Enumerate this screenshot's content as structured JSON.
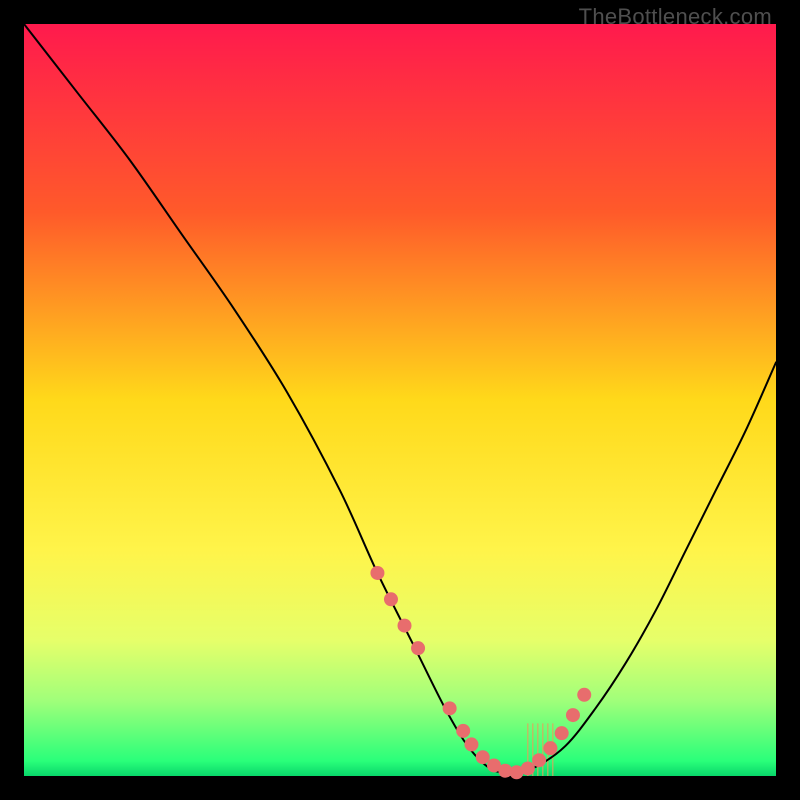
{
  "watermark": "TheBottleneck.com",
  "chart_data": {
    "type": "line",
    "title": "",
    "xlabel": "",
    "ylabel": "",
    "xlim": [
      0,
      100
    ],
    "ylim": [
      0,
      100
    ],
    "series": [
      {
        "name": "bottleneck-curve",
        "x": [
          0,
          7,
          14,
          21,
          28,
          35,
          42,
          47,
          52,
          56,
          59,
          62,
          65,
          68,
          72,
          76,
          80,
          84,
          88,
          92,
          96,
          100
        ],
        "y": [
          100,
          91,
          82,
          72,
          62,
          51,
          38,
          27,
          17,
          9,
          4,
          1,
          0.4,
          1.2,
          4,
          9,
          15,
          22,
          30,
          38,
          46,
          55
        ]
      }
    ],
    "markers": {
      "name": "highlight-dots",
      "x": [
        47,
        48.8,
        50.6,
        52.4,
        56.6,
        58.4,
        59.5,
        61,
        62.5,
        64,
        65.5,
        67,
        68.5,
        70,
        71.5,
        73,
        74.5
      ],
      "y": [
        27,
        23.5,
        20,
        17,
        9,
        6,
        4.2,
        2.5,
        1.4,
        0.7,
        0.5,
        1,
        2.1,
        3.7,
        5.7,
        8.1,
        10.8
      ]
    },
    "hatch_band": {
      "x_start": 67,
      "x_end": 70.5,
      "y_bottom": 0,
      "y_top": 7
    }
  }
}
